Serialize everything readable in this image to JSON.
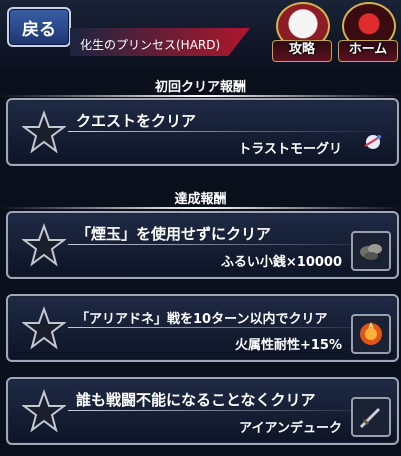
{
  "topbar": {
    "back_label": "戻る",
    "quest_title": "化生のプリンセス(HARD)",
    "guide_label": "攻略",
    "home_label": "ホーム"
  },
  "sections": {
    "first_clear_header": "初回クリア報酬",
    "achievement_header": "達成報酬"
  },
  "first_clear": {
    "condition": "クエストをクリア",
    "reward": "トラストモーグリ",
    "reward_icon": "moogle-icon"
  },
  "achievements": [
    {
      "condition": "「煙玉」を使用せずにクリア",
      "reward": "ふるい小銭×10000",
      "reward_icon": "coins-icon"
    },
    {
      "condition": "「アリアドネ」戦を10ターン以内でクリア",
      "reward": "火属性耐性+15%",
      "reward_icon": "fire-icon"
    },
    {
      "condition": "誰も戦闘不能になることなくクリア",
      "reward": "アイアンデューク",
      "reward_icon": "sword-icon"
    }
  ],
  "colors": {
    "accent_red": "#b0172c",
    "gold": "#d4b24c",
    "button_blue": "#3c5fa8"
  }
}
